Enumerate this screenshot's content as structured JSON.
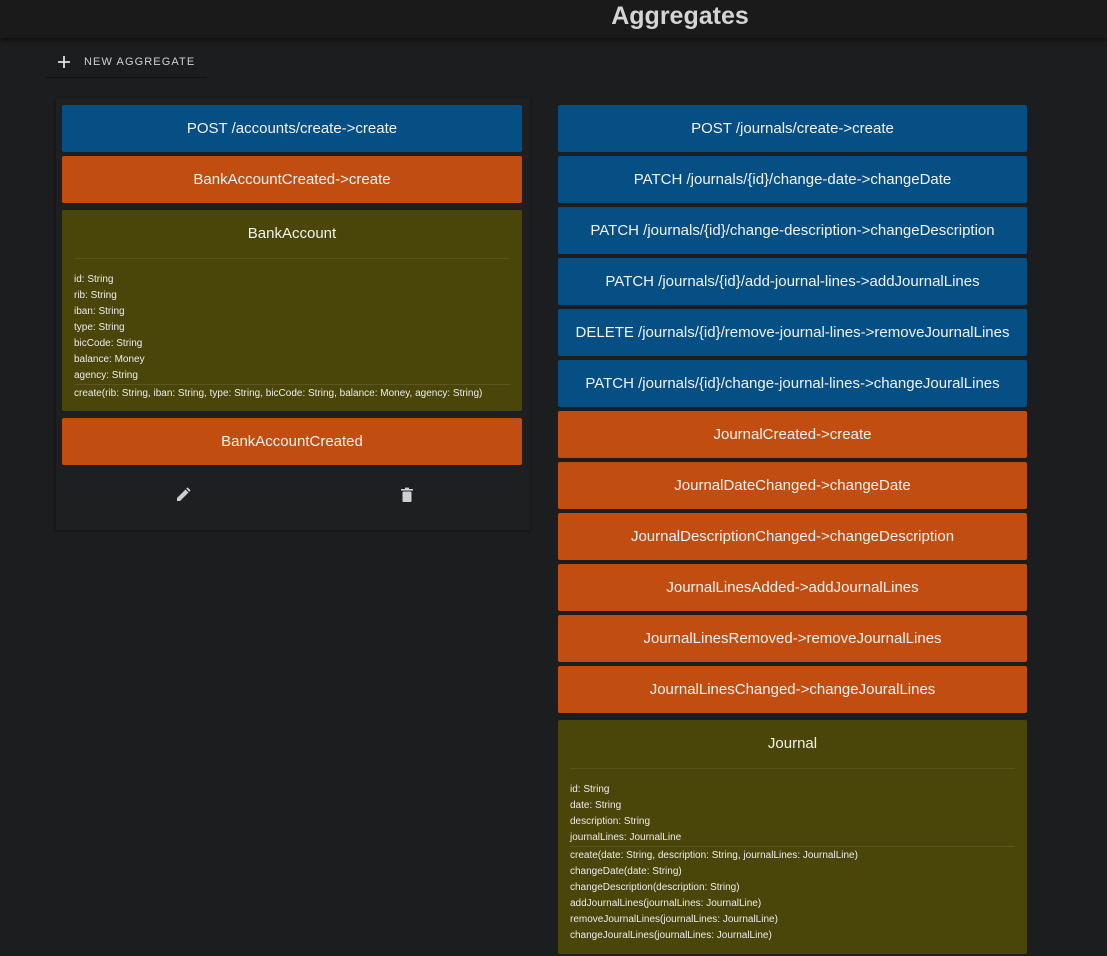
{
  "header": {
    "title": "Aggregates"
  },
  "toolbar": {
    "new_label": "NEW AGGREGATE",
    "new_icon": "plus-icon"
  },
  "colors": {
    "command": "#064f85",
    "event": "#c14d11",
    "aggregate": "#4a4509",
    "background": "#1c1d1f"
  },
  "aggregates": [
    {
      "commands": [
        "POST /accounts/create->create"
      ],
      "event_handlers": [
        "BankAccountCreated->create"
      ],
      "name": "BankAccount",
      "fields": [
        "id: String",
        "rib: String",
        "iban: String",
        "type: String",
        "bicCode: String",
        "balance: Money",
        "agency: String"
      ],
      "methods": [
        "create(rib: String, iban: String, type: String, bicCode: String, balance: Money, agency: String)"
      ],
      "events": [
        "BankAccountCreated"
      ],
      "actions": {
        "edit_icon": "pencil-icon",
        "delete_icon": "trash-icon"
      }
    },
    {
      "commands": [
        "POST /journals/create->create",
        "PATCH /journals/{id}/change-date->changeDate",
        "PATCH /journals/{id}/change-description->changeDescription",
        "PATCH /journals/{id}/add-journal-lines->addJournalLines",
        "DELETE /journals/{id}/remove-journal-lines->removeJournalLines",
        "PATCH /journals/{id}/change-journal-lines->changeJouralLines"
      ],
      "event_handlers": [
        "JournalCreated->create",
        "JournalDateChanged->changeDate",
        "JournalDescriptionChanged->changeDescription",
        "JournalLinesAdded->addJournalLines",
        "JournalLinesRemoved->removeJournalLines",
        "JournalLinesChanged->changeJouralLines"
      ],
      "name": "Journal",
      "fields": [
        "id: String",
        "date: String",
        "description: String",
        "journalLines: JournalLine"
      ],
      "methods": [
        "create(date: String, description: String, journalLines: JournalLine)",
        "changeDate(date: String)",
        "changeDescription(description: String)",
        "addJournalLines(journalLines: JournalLine)",
        "removeJournalLines(journalLines: JournalLine)",
        "changeJouralLines(journalLines: JournalLine)"
      ]
    }
  ]
}
